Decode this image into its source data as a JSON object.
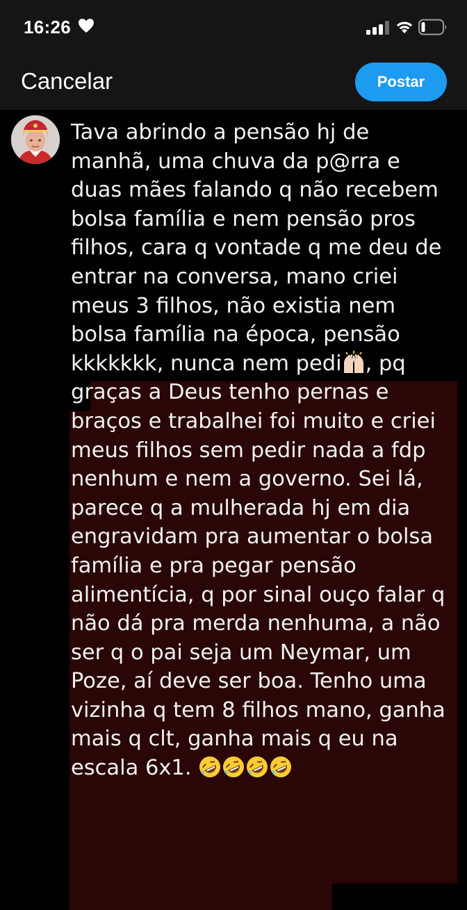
{
  "status_bar": {
    "time": "16:26",
    "icons": [
      "heart-icon",
      "signal-icon",
      "wifi-icon",
      "battery-icon"
    ]
  },
  "nav": {
    "cancel_label": "Cancelar",
    "post_label": "Postar"
  },
  "colors": {
    "accent": "#1d9bf0",
    "background": "#000000",
    "header_background": "#151516",
    "highlight": "#2a0606",
    "text": "#f2f2f2"
  },
  "tweet": {
    "lines": [
      "Tava abrindo a pensão hj de",
      "manhã, uma chuva da p@rra e",
      "duas mães falando q não recebem",
      "bolsa família e nem pensão pros",
      "filhos, cara q vontade q me deu de",
      "entrar na conversa, mano criei",
      "meus 3 filhos, não existia nem",
      "bolsa família na época, pensão",
      "kkkkkkk, nunca nem pedi",
      ", pq",
      "graças a Deus tenho pernas e",
      "braços e trabalhei foi muito e criei",
      "meus filhos sem pedir nada a fdp",
      "nenhum e nem a governo. Sei lá,",
      "parece q a mulherada hj em dia",
      "engravidam pra aumentar o bolsa",
      "família e pra pegar pensão",
      "alimentícia, q por sinal ouço falar q",
      "não dá pra merda nenhuma, a não",
      "ser q o pai seja um Neymar, um",
      "Poze, aí deve ser boa. Tenho uma",
      "vizinha q tem 8 filhos mano, ganha",
      "mais q clt, ganha mais q eu na",
      "escala 6x1. "
    ],
    "emojis": [
      "raising-hands-emoji",
      "rolling-laughing-emoji"
    ]
  }
}
